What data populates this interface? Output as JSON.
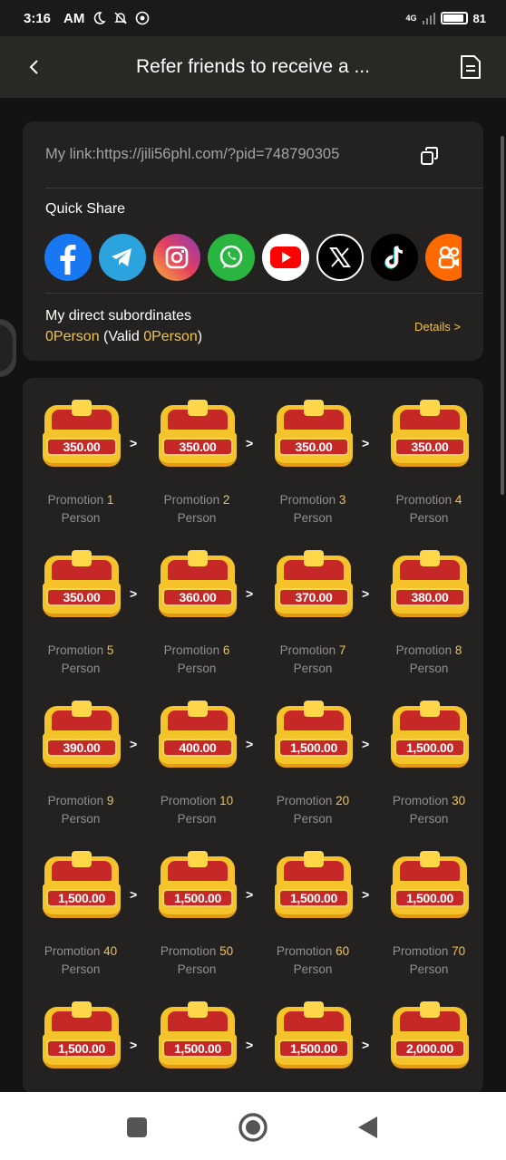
{
  "status_bar": {
    "time": "3:16",
    "ampm": "AM",
    "network": "4G",
    "battery": "81"
  },
  "header": {
    "title": "Refer friends to receive a ..."
  },
  "link_card": {
    "link_text": "My link:https://jili56phl.com/?pid=748790305",
    "quick_share_label": "Quick Share",
    "share_icons": [
      "facebook-icon",
      "telegram-icon",
      "instagram-icon",
      "whatsapp-icon",
      "youtube-icon",
      "x-icon",
      "tiktok-icon",
      "kwai-icon"
    ],
    "subordinates_label": "My direct subordinates",
    "count_value": "0Person",
    "valid_open": " (Valid ",
    "valid_value": "0Person",
    "valid_close": ")",
    "details_label": "Details >"
  },
  "tiers_label": {
    "promotion": "Promotion ",
    "person": "Person",
    "arrow": ">"
  },
  "tiers": [
    {
      "amount": "350.00",
      "count": "1"
    },
    {
      "amount": "350.00",
      "count": "2"
    },
    {
      "amount": "350.00",
      "count": "3"
    },
    {
      "amount": "350.00",
      "count": "4"
    },
    {
      "amount": "350.00",
      "count": "5"
    },
    {
      "amount": "360.00",
      "count": "6"
    },
    {
      "amount": "370.00",
      "count": "7"
    },
    {
      "amount": "380.00",
      "count": "8"
    },
    {
      "amount": "390.00",
      "count": "9"
    },
    {
      "amount": "400.00",
      "count": "10"
    },
    {
      "amount": "1,500.00",
      "count": "20"
    },
    {
      "amount": "1,500.00",
      "count": "30"
    },
    {
      "amount": "1,500.00",
      "count": "40"
    },
    {
      "amount": "1,500.00",
      "count": "50"
    },
    {
      "amount": "1,500.00",
      "count": "60"
    },
    {
      "amount": "1,500.00",
      "count": "70"
    },
    {
      "amount": "1,500.00",
      "count": ""
    },
    {
      "amount": "1,500.00",
      "count": ""
    },
    {
      "amount": "1,500.00",
      "count": ""
    },
    {
      "amount": "2,000.00",
      "count": ""
    }
  ],
  "colors": {
    "accent": "#f3c24a",
    "card": "#232220",
    "chest_red": "#c62828",
    "chest_gold": "#f5c42a"
  }
}
